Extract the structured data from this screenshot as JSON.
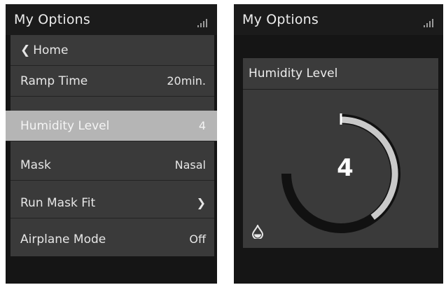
{
  "left": {
    "title": "My Options",
    "menu": [
      {
        "label": "Home",
        "value": "",
        "icon": "chevron-left-icon"
      },
      {
        "label": "Ramp Time",
        "value": "20min."
      },
      {
        "label": "Humidity Level",
        "value": "4",
        "highlighted": true
      },
      {
        "label": "Mask",
        "value": "Nasal"
      },
      {
        "label": "Run Mask Fit",
        "value": "",
        "icon": "chevron-right-icon"
      },
      {
        "label": "Airplane Mode",
        "value": "Off"
      }
    ]
  },
  "right": {
    "title": "My Options",
    "card_title": "Humidity Level",
    "level": "4",
    "level_fraction": 0.4,
    "icon": "water-drop-icon"
  },
  "colors": {
    "screen_bg": "#151515",
    "panel_bg": "#3a3a3a",
    "highlight": "#b5b5b5",
    "dial_track": "#111111",
    "dial_fill": "#c9c9c9",
    "text": "#ececec"
  }
}
